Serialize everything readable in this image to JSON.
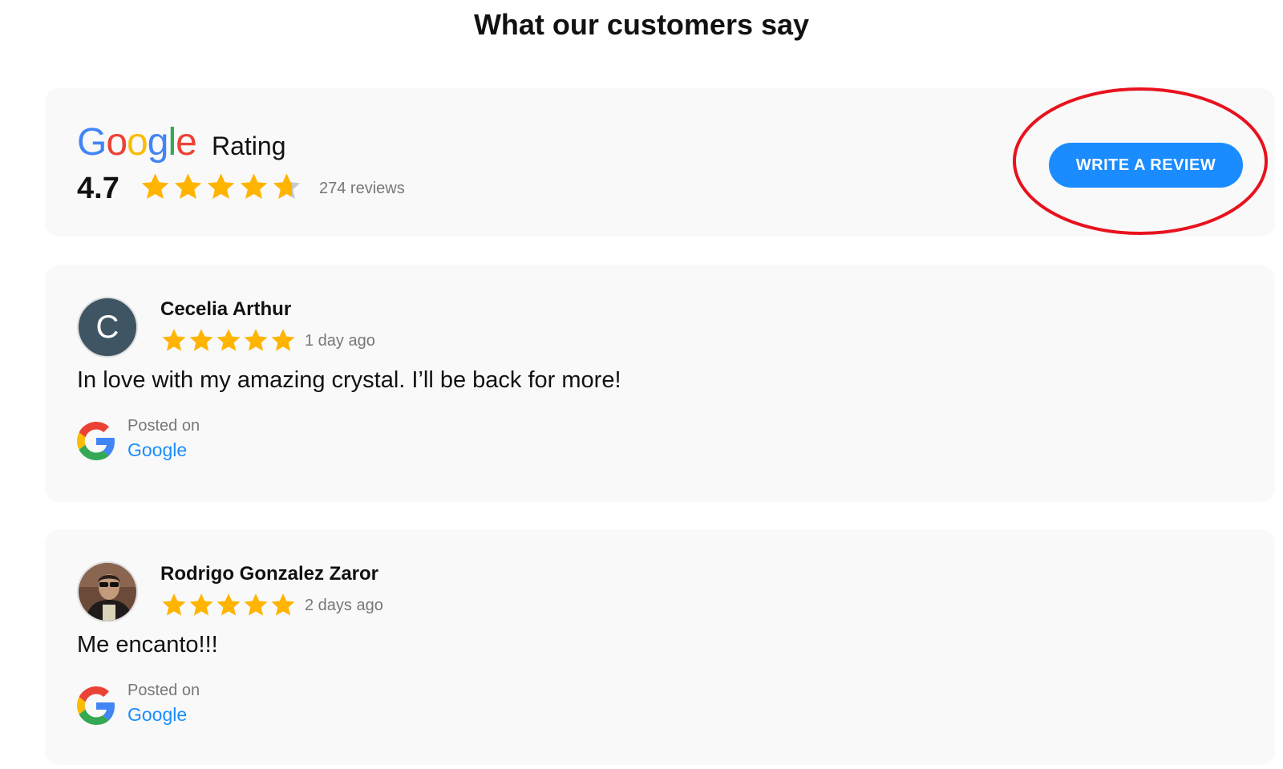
{
  "header": {
    "title": "What our customers say"
  },
  "summary": {
    "brand_letters": [
      {
        "ch": "G",
        "color": "#4285F4"
      },
      {
        "ch": "o",
        "color": "#EA4335"
      },
      {
        "ch": "o",
        "color": "#FBBC05"
      },
      {
        "ch": "g",
        "color": "#4285F4"
      },
      {
        "ch": "l",
        "color": "#34A853"
      },
      {
        "ch": "e",
        "color": "#EA4335"
      }
    ],
    "rating_label": "Rating",
    "rating_value": "4.7",
    "rating_fraction": 0.94,
    "review_count": "274 reviews",
    "write_review_label": "WRITE A REVIEW"
  },
  "annotation": {
    "highlight_color": "#e8121e",
    "shape": "ellipse"
  },
  "colors": {
    "star": "#ffb400",
    "star_empty": "#c8c8c8",
    "accent": "#1a8cff",
    "card_bg": "#f9f9f9"
  },
  "reviews": [
    {
      "name": "Cecelia Arthur",
      "avatar_letter": "C",
      "avatar_color": "#3f5563",
      "stars": 5,
      "date": "1 day ago",
      "text": "In love with my amazing crystal. I’ll be back for more!",
      "posted_label": "Posted on",
      "posted_source": "Google",
      "source_icon": "google-g-icon"
    },
    {
      "name": "Rodrigo Gonzalez Zaror",
      "avatar_letter": "",
      "avatar_color": "#3b2d27",
      "stars": 5,
      "date": "2 days ago",
      "text": "Me encanto!!!",
      "posted_label": "Posted on",
      "posted_source": "Google",
      "source_icon": "google-g-icon"
    }
  ]
}
